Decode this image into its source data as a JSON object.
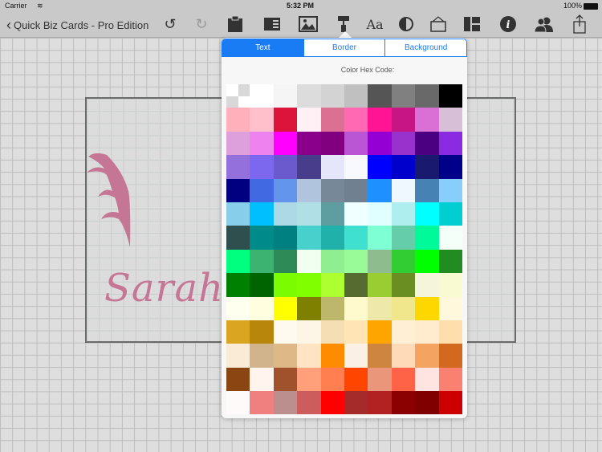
{
  "status": {
    "carrier": "Carrier",
    "time": "5:32 PM",
    "battery": "100%"
  },
  "nav": {
    "back_label": "Quick Biz Cards - Pro Edition"
  },
  "toolbar": {
    "icons": [
      "undo-icon",
      "redo-icon",
      "clipboard-icon",
      "card-layout-icon",
      "image-icon",
      "paint-roller-icon",
      "font-icon",
      "contrast-icon",
      "frame-icon",
      "template-icon",
      "info-icon",
      "contacts-icon",
      "share-icon"
    ],
    "font_label": "Aa"
  },
  "card": {
    "name": "Sarah",
    "accent": "#c47694"
  },
  "popover": {
    "tabs": [
      "Text",
      "Border",
      "Background"
    ],
    "active_tab": "Text",
    "hex_label": "Color Hex Code:",
    "colors": [
      [
        "clear",
        "#ffffff",
        "#f5f5f5",
        "#dcdcdc",
        "#d3d3d3",
        "#c0c0c0",
        "#555555",
        "#808080",
        "#696969",
        "#000000"
      ],
      [
        "#ffb0bb",
        "#ffc0cb",
        "#dc143c",
        "#fff0f5",
        "#db7093",
        "#ff69b4",
        "#ff1493",
        "#c71585",
        "#da70d6",
        "#d8bfd8"
      ],
      [
        "#dda0dd",
        "#ee82ee",
        "#ff00ff",
        "#8b008b",
        "#800080",
        "#ba55d3",
        "#9400d3",
        "#9932cc",
        "#4b0082",
        "#8a2be2"
      ],
      [
        "#9370db",
        "#7b68ee",
        "#6a5acd",
        "#483d8b",
        "#e6e6fa",
        "#f8f8ff",
        "#0000ff",
        "#0000cd",
        "#191970",
        "#00008b"
      ],
      [
        "#000080",
        "#4169e1",
        "#6495ed",
        "#b0c4de",
        "#778899",
        "#708090",
        "#1e90ff",
        "#f0f8ff",
        "#4682b4",
        "#87cefa"
      ],
      [
        "#87ceeb",
        "#00bfff",
        "#add8e6",
        "#b0e0e6",
        "#5f9ea0",
        "#f0ffff",
        "#e0ffff",
        "#afeeee",
        "#00ffff",
        "#00ced1"
      ],
      [
        "#2f4f4f",
        "#008b8b",
        "#008080",
        "#48d1cc",
        "#20b2aa",
        "#40e0d0",
        "#7fffd4",
        "#66cdaa",
        "#00fa9a",
        "#f5fffa"
      ],
      [
        "#00ff7f",
        "#3cb371",
        "#2e8b57",
        "#f0fff0",
        "#90ee90",
        "#98fb98",
        "#8fbc8f",
        "#32cd32",
        "#00ff00",
        "#228b22"
      ],
      [
        "#008000",
        "#006400",
        "#7cfc00",
        "#7fff00",
        "#adff2f",
        "#556b2f",
        "#9acd32",
        "#6b8e23",
        "#f5f5dc",
        "#fafad2"
      ],
      [
        "#fffff0",
        "#ffffe0",
        "#ffff00",
        "#808000",
        "#bdb76b",
        "#fffacd",
        "#eee8aa",
        "#f0e68c",
        "#ffd700",
        "#fff8dc"
      ],
      [
        "#daa520",
        "#b8860b",
        "#fffaf0",
        "#fdf5e6",
        "#f5deb3",
        "#ffe4b5",
        "#ffa500",
        "#ffefd5",
        "#ffebcd",
        "#ffdead"
      ],
      [
        "#faebd7",
        "#d2b48c",
        "#deb887",
        "#ffe4c4",
        "#ff8c00",
        "#faf0e6",
        "#cd853f",
        "#ffdab9",
        "#f4a460",
        "#d2691e"
      ],
      [
        "#8b4513",
        "#fff5ee",
        "#a0522d",
        "#ffa07a",
        "#ff7f50",
        "#ff4500",
        "#e9967a",
        "#ff6347",
        "#ffe4e1",
        "#fa8072"
      ],
      [
        "#fffafa",
        "#f08080",
        "#bc8f8f",
        "#cd5c5c",
        "#ff0000",
        "#a52a2a",
        "#b22222",
        "#8b0000",
        "#800000",
        "#cc0000"
      ]
    ]
  },
  "colors": {
    "accent": "#1a7cf5",
    "navbar": "#c9c9c9"
  }
}
